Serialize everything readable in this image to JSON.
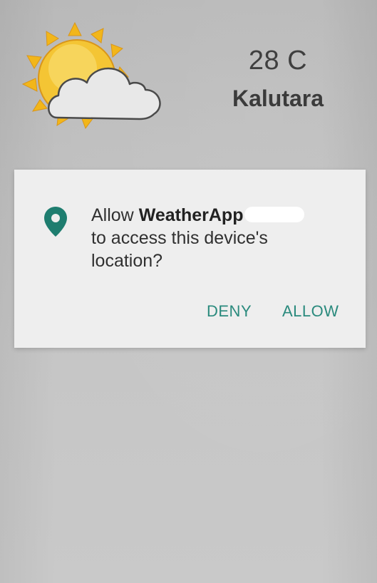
{
  "weather": {
    "icon": "partly-cloudy-sun-icon",
    "temperature": "28 C",
    "city": "Kalutara"
  },
  "permission_dialog": {
    "icon": "location-pin-icon",
    "message_prefix": "Allow ",
    "app_name": "WeatherApp",
    "message_line2": "to access this device's",
    "message_line3": "location?",
    "deny_label": "DENY",
    "allow_label": "ALLOW"
  },
  "colors": {
    "accent": "#2a8a7d",
    "sun": "#f2b61a",
    "dialog_background": "#eeeeee"
  }
}
